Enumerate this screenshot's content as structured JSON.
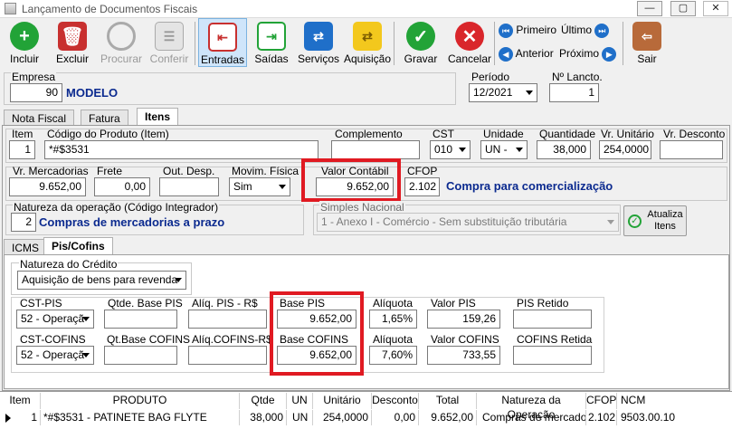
{
  "window": {
    "title": "Lançamento de Documentos Fiscais",
    "min": "—",
    "max": "▢",
    "close": "✕"
  },
  "toolbar": {
    "incluir": "Incluir",
    "excluir": "Excluir",
    "procurar": "Procurar",
    "conferir": "Conferir",
    "entradas": "Entradas",
    "saidas": "Saídas",
    "servicos": "Serviços",
    "aquisicao": "Aquisição",
    "gravar": "Gravar",
    "cancelar": "Cancelar",
    "primeiro": "Primeiro",
    "ultimo": "Último",
    "anterior": "Anterior",
    "proximo": "Próximo",
    "sair": "Sair"
  },
  "header": {
    "empresa_label": "Empresa",
    "empresa_code": "90",
    "empresa_name": "MODELO",
    "periodo_label": "Período",
    "periodo_value": "12/2021",
    "lancto_label": "Nº Lancto.",
    "lancto_value": "1"
  },
  "tabs": {
    "nota": "Nota Fiscal",
    "fatura": "Fatura",
    "itens": "Itens"
  },
  "item": {
    "item_label": "Item",
    "item_value": "1",
    "codigo_label": "Código do Produto (Item)",
    "codigo_value": "*#$3531",
    "complemento_label": "Complemento",
    "cst_label": "CST",
    "cst_value": "010",
    "unidade_label": "Unidade",
    "unidade_value": "UN -",
    "quantidade_label": "Quantidade",
    "quantidade_value": "38,000",
    "vr_unitario_label": "Vr. Unitário",
    "vr_unitario_value": "254,0000",
    "vr_desconto_label": "Vr. Desconto",
    "vr_merc_label": "Vr. Mercadorias",
    "vr_merc_value": "9.652,00",
    "frete_label": "Frete",
    "frete_value": "0,00",
    "out_desp_label": "Out. Desp.",
    "mov_fisica_label": "Movim. Física",
    "mov_fisica_value": "Sim",
    "valor_contabil_label": "Valor Contábil",
    "valor_contabil_value": "9.652,00",
    "cfop_label": "CFOP",
    "cfop_value": "2.102",
    "cfop_desc": "Compra para comercialização",
    "natureza_label": "Natureza da operação (Código Integrador)",
    "natureza_code": "2",
    "natureza_desc": "Compras de mercadorias a prazo",
    "simples_label": "Simples Nacional",
    "simples_value": "1 - Anexo I -   Comércio - Sem substituição tributária",
    "atualiza_label": "Atualiza Itens"
  },
  "subtabs": {
    "icms": "ICMS",
    "pis": "Pis/Cofins"
  },
  "pis": {
    "natureza_credito_label": "Natureza do Crédito",
    "natureza_credito_value": "Aquisição de bens para revenda",
    "cst_pis_label": "CST-PIS",
    "cst_pis_value": "52 - Operaçã",
    "qtde_base_pis_label": "Qtde. Base PIS",
    "aliq_pis_rs_label": "Alíq. PIS - R$",
    "base_pis_label": "Base PIS",
    "base_pis_value": "9.652,00",
    "aliquota_label": "Alíquota",
    "aliquota_pis_value": "1,65%",
    "valor_pis_label": "Valor PIS",
    "valor_pis_value": "159,26",
    "pis_retido_label": "PIS Retido",
    "cst_cofins_label": "CST-COFINS",
    "cst_cofins_value": "52 - Operaçã",
    "qt_base_cofins_label": "Qt.Base COFINS",
    "aliq_cofins_rs_label": "Alíq.COFINS-R$",
    "base_cofins_label": "Base COFINS",
    "base_cofins_value": "9.652,00",
    "aliquota_cofins_label": "Alíquota",
    "aliquota_cofins_value": "7,60%",
    "valor_cofins_label": "Valor COFINS",
    "valor_cofins_value": "733,55",
    "cofins_retida_label": "COFINS Retida"
  },
  "grid": {
    "headers": [
      "Item",
      "PRODUTO",
      "Qtde",
      "UN",
      "Unitário",
      "Desconto",
      "Total",
      "Natureza da Operação",
      "CFOP",
      "NCM"
    ],
    "rows": [
      {
        "item": "1",
        "produto": "*#$3531 - PATINETE BAG FLYTE",
        "qtde": "38,000",
        "un": "UN",
        "unitario": "254,0000",
        "desconto": "0,00",
        "total": "9.652,00",
        "natureza": "Compras de mercadorias",
        "cfop": "2.102",
        "ncm": "9503.00.10"
      }
    ]
  },
  "colors": {
    "accent_red": "#e01a22",
    "text_blue": "#0b2a8f"
  }
}
